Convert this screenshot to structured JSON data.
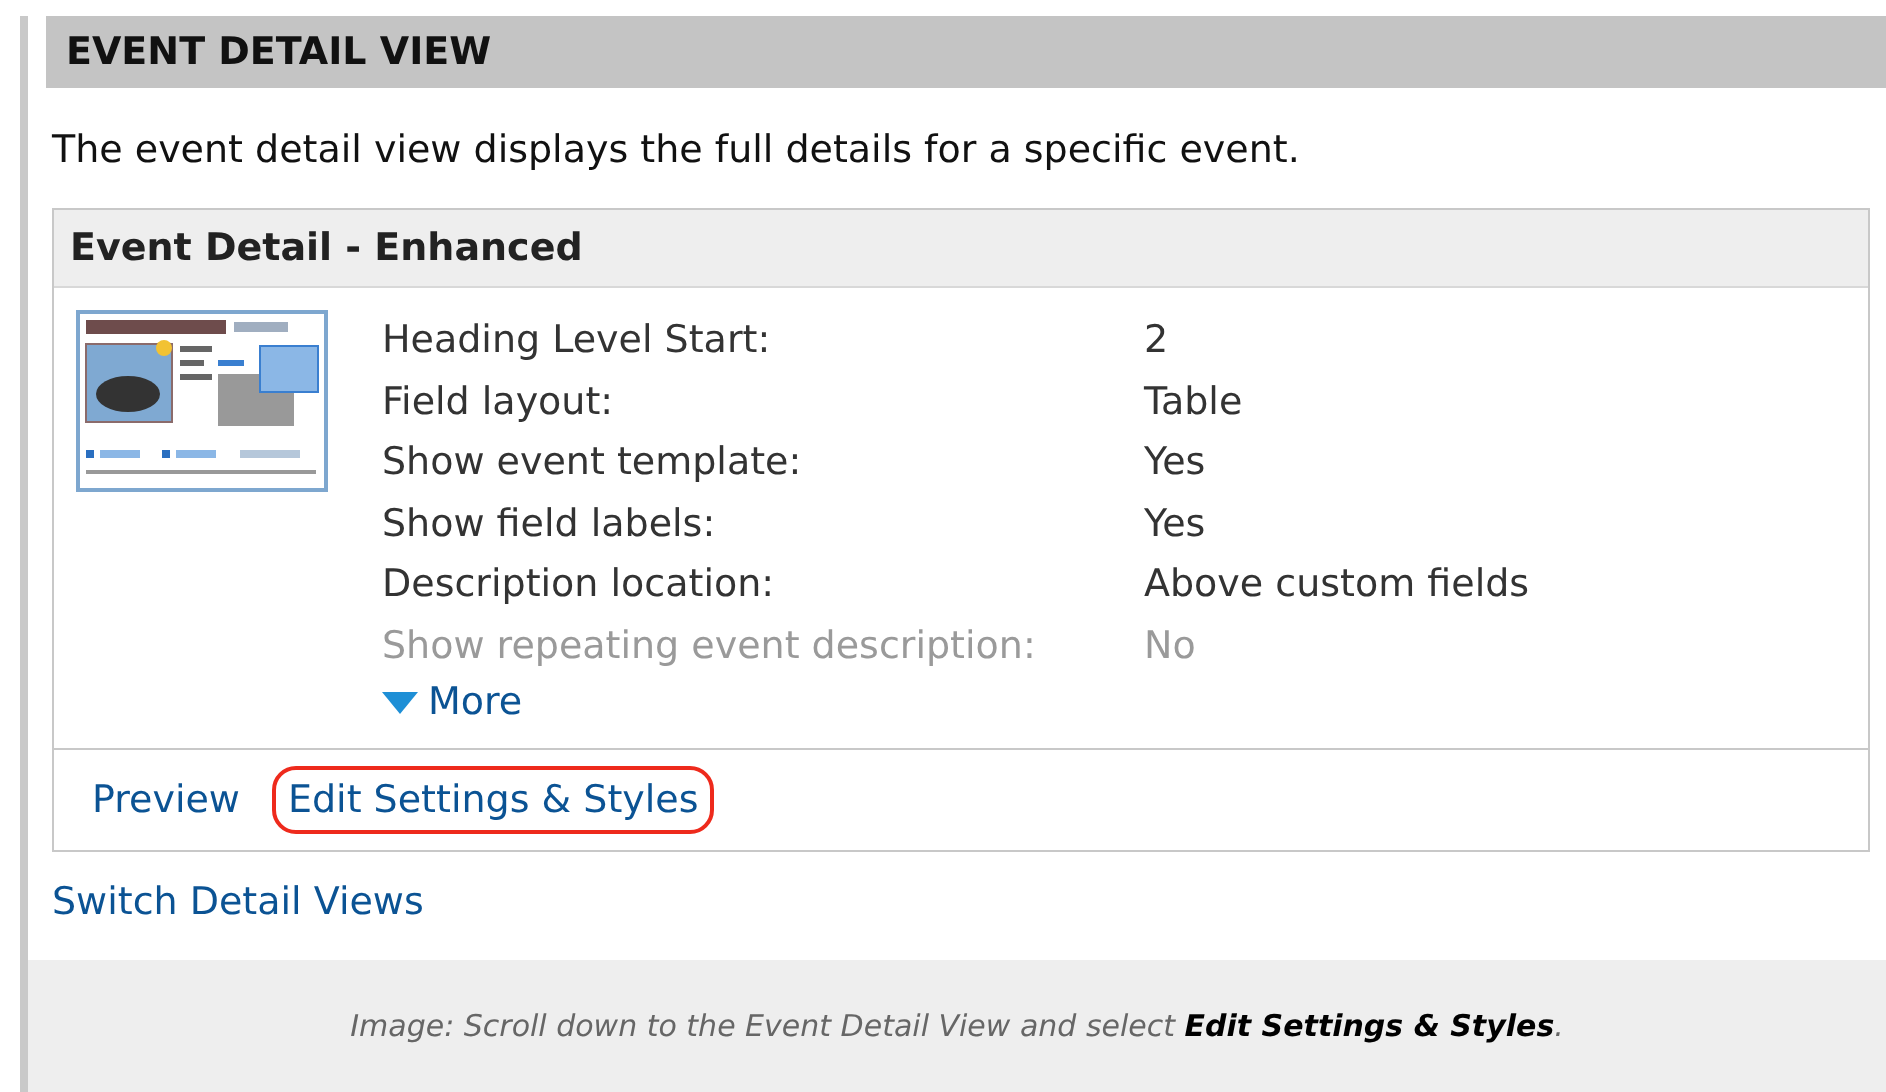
{
  "section": {
    "title": "EVENT DETAIL VIEW",
    "description": "The event detail view displays the full details for a specific event."
  },
  "card": {
    "title": "Event Detail - Enhanced",
    "settings": [
      {
        "label": "Heading Level Start:",
        "value": "2",
        "faded": false
      },
      {
        "label": "Field layout:",
        "value": "Table",
        "faded": false
      },
      {
        "label": "Show event template:",
        "value": "Yes",
        "faded": false
      },
      {
        "label": "Show field labels:",
        "value": "Yes",
        "faded": false
      },
      {
        "label": "Description location:",
        "value": "Above custom fields",
        "faded": false
      },
      {
        "label": "Show repeating event description:",
        "value": "No",
        "faded": true
      }
    ],
    "more": {
      "label": "More",
      "expanded": false
    },
    "links": [
      {
        "label": "Preview",
        "highlighted": false
      },
      {
        "label": "Edit Settings & Styles",
        "highlighted": true
      }
    ]
  },
  "switch_link": "Switch Detail Views",
  "caption": "Image: Scroll down to the Event Detail View and select **Edit Settings & Styles**."
}
